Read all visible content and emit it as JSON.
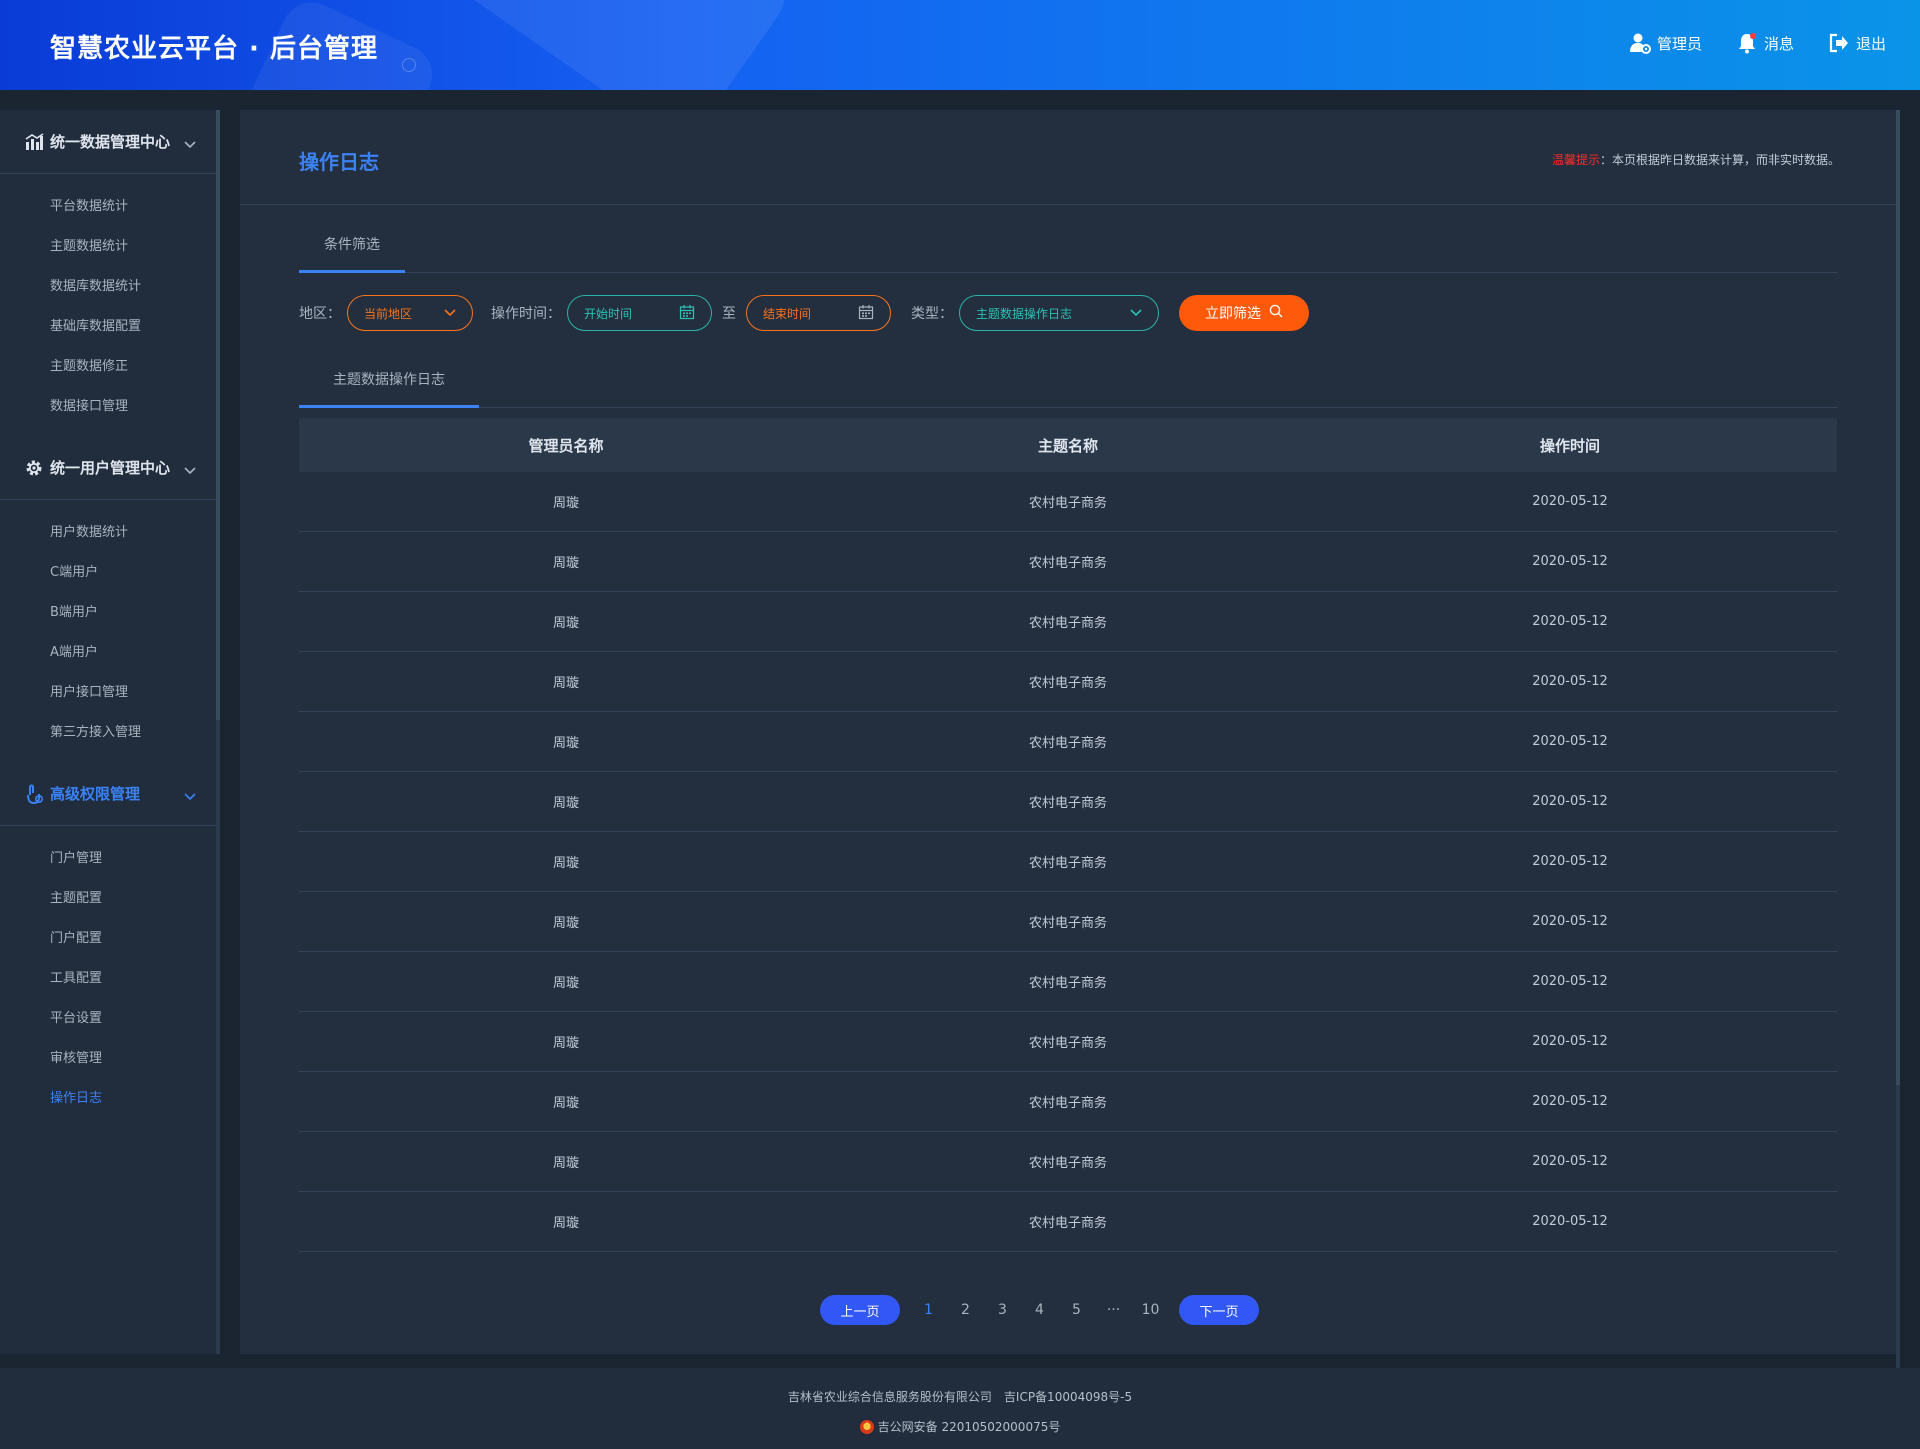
{
  "header": {
    "title": "智慧农业云平台 · 后台管理",
    "actions": [
      {
        "label": "管理员",
        "icon": "user-gear-icon"
      },
      {
        "label": "消息",
        "icon": "bell-icon"
      },
      {
        "label": "退出",
        "icon": "logout-icon"
      }
    ]
  },
  "sidebar": {
    "groups": [
      {
        "label": "统一数据管理中心",
        "icon": "chart-icon",
        "items": [
          "平台数据统计",
          "主题数据统计",
          "数据库数据统计",
          "基础库数据配置",
          "主题数据修正",
          "数据接口管理"
        ]
      },
      {
        "label": "统一用户管理中心",
        "icon": "gear-icon",
        "items": [
          "用户数据统计",
          "C端用户",
          "B端用户",
          "A端用户",
          "用户接口管理",
          "第三方接入管理"
        ]
      },
      {
        "label": "高级权限管理",
        "icon": "permission-icon",
        "items": [
          "门户管理",
          "主题配置",
          "门户配置",
          "工具配置",
          "平台设置",
          "审核管理",
          "操作日志"
        ]
      }
    ],
    "active_item": "操作日志"
  },
  "page": {
    "title": "操作日志",
    "notice_prefix": "温馨提示",
    "notice_text": "：本页根据昨日数据来计算，而非实时数据。"
  },
  "filter_tab": "条件筛选",
  "filters": {
    "region_label": "地区：",
    "region_value": "当前地区",
    "time_label": "操作时间：",
    "start_placeholder": "开始时间",
    "to": "至",
    "end_placeholder": "结束时间",
    "type_label": "类型：",
    "type_value": "主题数据操作日志",
    "submit": "立即筛选"
  },
  "result_tab": "主题数据操作日志",
  "table": {
    "headers": [
      "管理员名称",
      "主题名称",
      "操作时间"
    ],
    "rows": [
      [
        "周璇",
        "农村电子商务",
        "2020-05-12"
      ],
      [
        "周璇",
        "农村电子商务",
        "2020-05-12"
      ],
      [
        "周璇",
        "农村电子商务",
        "2020-05-12"
      ],
      [
        "周璇",
        "农村电子商务",
        "2020-05-12"
      ],
      [
        "周璇",
        "农村电子商务",
        "2020-05-12"
      ],
      [
        "周璇",
        "农村电子商务",
        "2020-05-12"
      ],
      [
        "周璇",
        "农村电子商务",
        "2020-05-12"
      ],
      [
        "周璇",
        "农村电子商务",
        "2020-05-12"
      ],
      [
        "周璇",
        "农村电子商务",
        "2020-05-12"
      ],
      [
        "周璇",
        "农村电子商务",
        "2020-05-12"
      ],
      [
        "周璇",
        "农村电子商务",
        "2020-05-12"
      ],
      [
        "周璇",
        "农村电子商务",
        "2020-05-12"
      ],
      [
        "周璇",
        "农村电子商务",
        "2020-05-12"
      ]
    ]
  },
  "pagination": {
    "prev": "上一页",
    "pages": [
      "1",
      "2",
      "3",
      "4",
      "5",
      "···",
      "10"
    ],
    "current": "1",
    "next": "下一页"
  },
  "footer": {
    "company": "吉林省农业综合信息服务股份有限公司",
    "icp": "吉ICP备10004098号-5",
    "police": "吉公网安备 22010502000075号"
  },
  "colors": {
    "accent": "#3b82f6",
    "orange": "#ff5a0a",
    "teal": "#2bc2b2",
    "warning": "#ff2a2a",
    "background": "#1b2532"
  }
}
